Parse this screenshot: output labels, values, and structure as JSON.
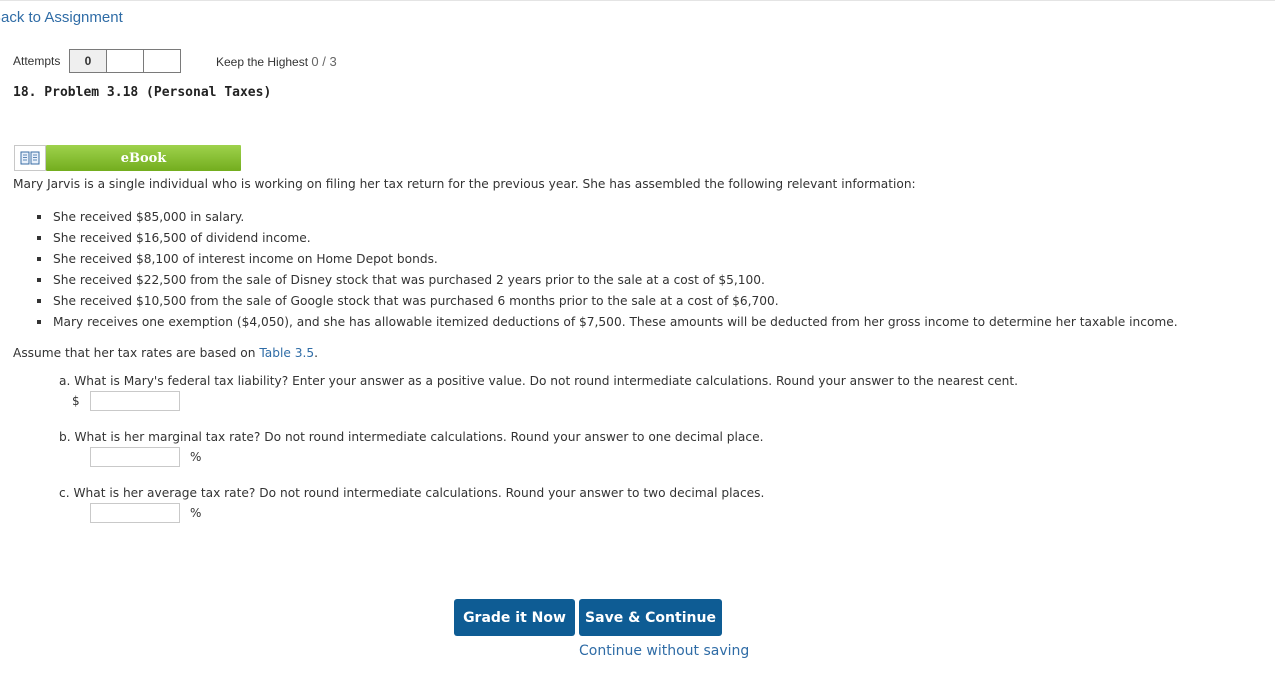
{
  "nav": {
    "back_label": "Back to Assignment"
  },
  "attempts": {
    "label": "Attempts",
    "boxes": [
      "0",
      "",
      ""
    ],
    "keep_label": "Keep the Highest",
    "score": "0 / 3"
  },
  "problem": {
    "title": "18.  Problem 3.18 (Personal Taxes)"
  },
  "ebook": {
    "label": "eBook",
    "icon": "book-icon"
  },
  "intro": "Mary Jarvis is a single individual who is working on filing her tax return for the previous year. She has assembled the following relevant information:",
  "facts": [
    "She received $85,000 in salary.",
    "She received $16,500 of dividend income.",
    "She received $8,100 of interest income on Home Depot bonds.",
    "She received $22,500 from the sale of Disney stock that was purchased 2 years prior to the sale at a cost of $5,100.",
    "She received $10,500 from the sale of Google stock that was purchased 6 months prior to the sale at a cost of $6,700.",
    "Mary receives one exemption ($4,050), and she has allowable itemized deductions of $7,500. These amounts will be deducted from her gross income to determine her taxable income."
  ],
  "assume": {
    "prefix": "Assume that her tax rates are based on ",
    "link": "Table 3.5",
    "suffix": "."
  },
  "questions": {
    "a": {
      "text": "a. What is Mary's federal tax liability? Enter your answer as a positive value. Do not round intermediate calculations. Round your answer to the nearest cent.",
      "prefix": "$",
      "value": ""
    },
    "b": {
      "text": "b. What is her marginal tax rate? Do not round intermediate calculations. Round your answer to one decimal place.",
      "suffix": "%",
      "value": ""
    },
    "c": {
      "text": "c. What is her average tax rate? Do not round intermediate calculations. Round your answer to two decimal places.",
      "suffix": "%",
      "value": ""
    }
  },
  "actions": {
    "grade_label": "Grade it Now",
    "save_label": "Save & Continue",
    "continue_label": "Continue without saving"
  },
  "colors": {
    "link": "#2f6ca6",
    "primary_button": "#0e5c94",
    "ebook_green": "#8cc63f"
  }
}
